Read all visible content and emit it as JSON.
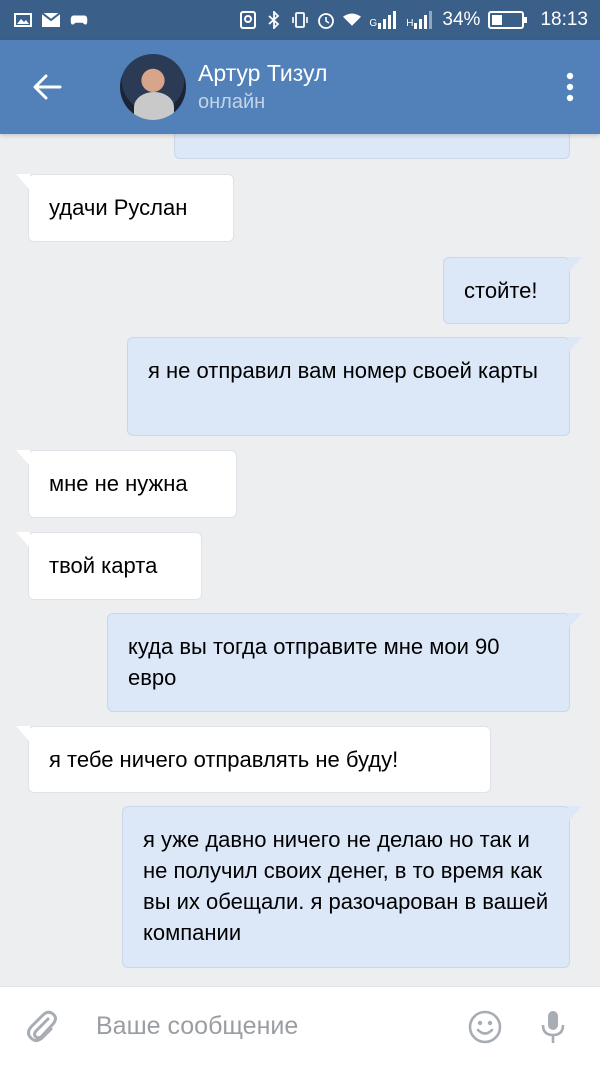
{
  "status_bar": {
    "battery_percent": "34%",
    "time": "18:13",
    "signal_1_label": "G",
    "signal_2_label": "H",
    "battery_level": 0.34,
    "icons": [
      "gallery-icon",
      "mail-icon",
      "gamepad-icon",
      "location-icon",
      "bluetooth-icon",
      "vibrate-icon",
      "alarm-icon",
      "wifi-icon",
      "signal-icon",
      "signal-icon",
      "battery-icon"
    ]
  },
  "header": {
    "contact_name": "Артур Тизул",
    "contact_status": "онлайн",
    "colors": {
      "bar": "#5181b8",
      "status_bar": "#3a5f89"
    }
  },
  "messages": [
    {
      "side": "out",
      "text": ""
    },
    {
      "side": "in",
      "text": "удачи Руслан"
    },
    {
      "side": "out",
      "text": "стойте!"
    },
    {
      "side": "out",
      "text": "я не отправил вам номер своей карты"
    },
    {
      "side": "in",
      "text": "мне не нужна"
    },
    {
      "side": "in",
      "text": "твой карта"
    },
    {
      "side": "out",
      "text": "куда вы тогда отправите мне мои 90 евро"
    },
    {
      "side": "in",
      "text": "я тебе ничего отправлять не буду!"
    },
    {
      "side": "out",
      "text": "я уже давно ничего не делаю но так и не получил своих денег, в то время как вы их обещали. я разочарован в вашей компании"
    }
  ],
  "composer": {
    "placeholder": "Ваше сообщение",
    "value": ""
  }
}
